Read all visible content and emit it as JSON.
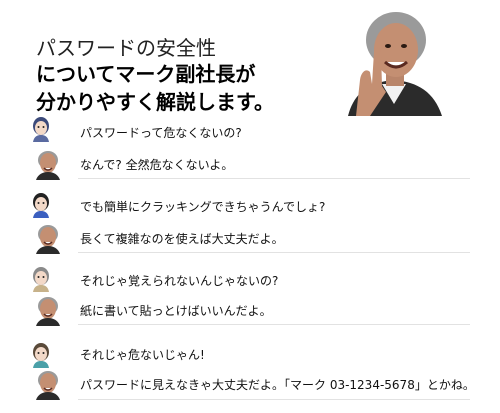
{
  "header": {
    "line1": "パスワードの安全性",
    "line2": "についてマーク副社長が",
    "line3": "分かりやすく解説します。"
  },
  "conversation": [
    {
      "speaker": "user-avatar-1",
      "text": "パスワードって危なくないの?"
    },
    {
      "speaker": "mark",
      "text": "なんで? 全然危なくないよ。"
    },
    {
      "speaker": "user-avatar-2",
      "text": "でも簡単にクラッキングできちゃうんでしょ?"
    },
    {
      "speaker": "mark",
      "text": "長くて複雑なのを使えば大丈夫だよ。"
    },
    {
      "speaker": "user-avatar-3",
      "text": "それじゃ覚えられないんじゃないの?"
    },
    {
      "speaker": "mark",
      "text": "紙に書いて貼っとけばいいんだよ。"
    },
    {
      "speaker": "user-avatar-4",
      "text": "それじゃ危ないじゃん!"
    },
    {
      "speaker": "mark",
      "text": "パスワードに見えなきゃ大丈夫だよ。「マーク 03-1234-5678」とかね。"
    }
  ]
}
